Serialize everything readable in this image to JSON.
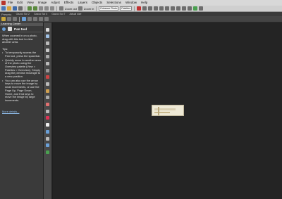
{
  "menu": {
    "items": [
      "File",
      "Edit",
      "View",
      "Image",
      "Adjust",
      "Effects",
      "Layers",
      "Objects",
      "Selections",
      "Window",
      "Help"
    ]
  },
  "toolbar": {
    "presets_label": "Presets:",
    "zoom_out_label": "Zoom out",
    "zoom_in_label": "Zoom in",
    "enhance_photo_label": "Enhance Photo",
    "palettes_label": "Palettes"
  },
  "tabs": [
    "Gazoo Soi 2",
    "Gazoo Soi 4",
    "Gazoo Soi 7",
    "Actual size"
  ],
  "learning_center": {
    "header": "Learning Center",
    "tool_title": "Pan tool",
    "intro": "When zoomed in on a photo, drag with this tool to view another area.",
    "tips_label": "Tips:",
    "tips": [
      "To temporarily access the Pan tool, press the spacebar.",
      "Quickly move to another area of the photo using the Overview palette (View > Palettes > Overview). Simply drag the preview rectangle to a new position.",
      "You can also use the arrow keys to move the image by small increments, or use the Page Up, Page Down, Home, and End keys to move the image by large increments."
    ],
    "more_link": "More details..."
  },
  "colors": {
    "workspace": "#242424",
    "panel": "#3a3a3a",
    "menubar": "#d8d8d8",
    "link": "#8fbcea"
  }
}
